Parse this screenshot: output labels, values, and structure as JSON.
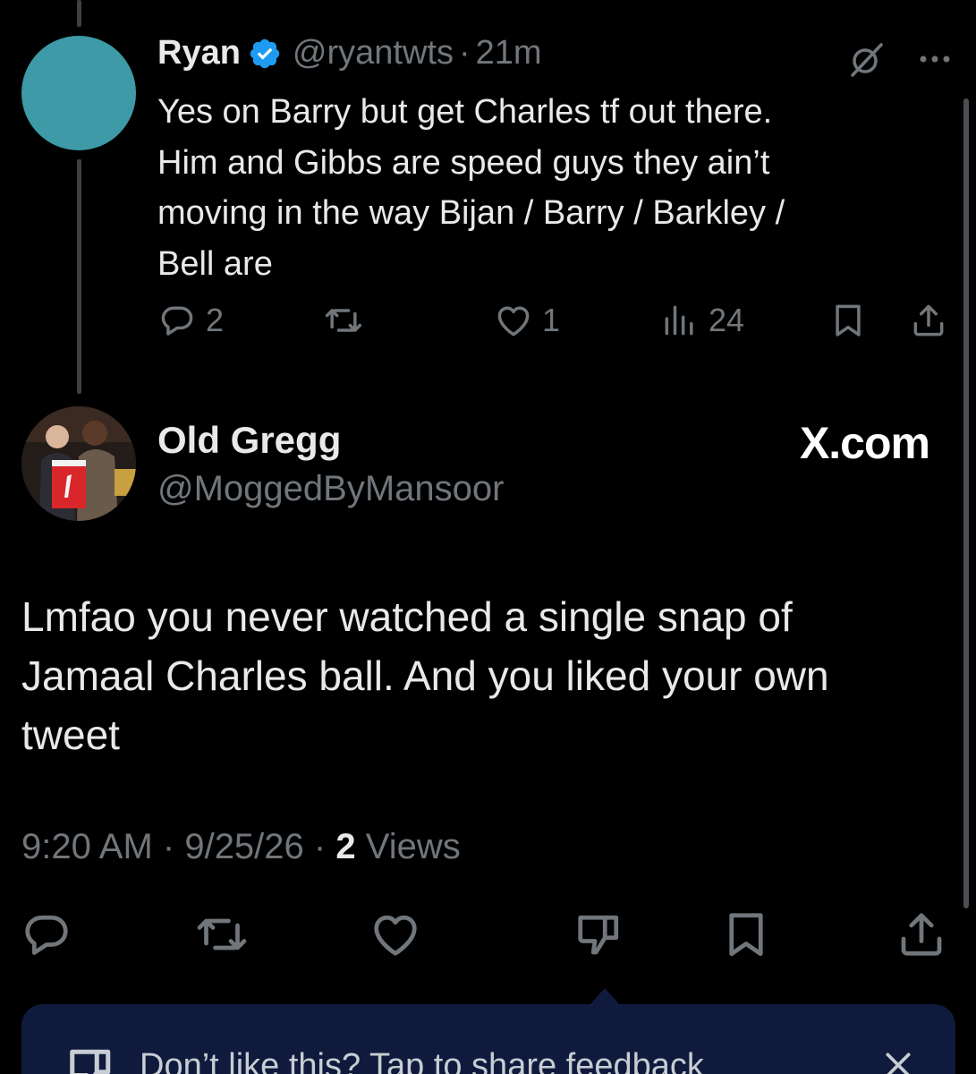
{
  "parent_tweet": {
    "name": "Ryan",
    "handle": "@ryantwts",
    "separator": "·",
    "time": "21m",
    "text_lines": [
      "Yes on Barry but get Charles tf out there.",
      "Him and Gibbs are speed guys they ain’t",
      "moving in the way Bijan / Barry / Barkley /",
      "Bell are"
    ],
    "replies": "2",
    "likes": "1",
    "views": "24",
    "avatar_color": "#3d9aa6",
    "verified_color": "#1d9bf0"
  },
  "main_tweet": {
    "name": "Old Gregg",
    "handle": "@MoggedByMansoor",
    "watermark": "X.com",
    "text_lines": [
      "Lmfao you never watched a single snap of",
      "Jamaal Charles ball. And you liked your own",
      "tweet"
    ],
    "time": "9:20 AM",
    "date": "9/25/26",
    "views_count": "2",
    "views_label": "Views"
  },
  "feedback_banner": {
    "text": "Don’t like this? Tap to share feedback"
  },
  "icons": {
    "reply": "reply-icon",
    "retweet": "retweet-icon",
    "like": "heart-icon",
    "views": "views-icon",
    "bookmark": "bookmark-icon",
    "share": "share-icon",
    "dislike": "thumbs-down-icon",
    "grok": "grok-icon",
    "more": "more-icon",
    "close": "close-icon"
  },
  "colors": {
    "background": "#000000",
    "text": "#e7e9ea",
    "muted": "#71767b",
    "banner": "#101a3c"
  }
}
